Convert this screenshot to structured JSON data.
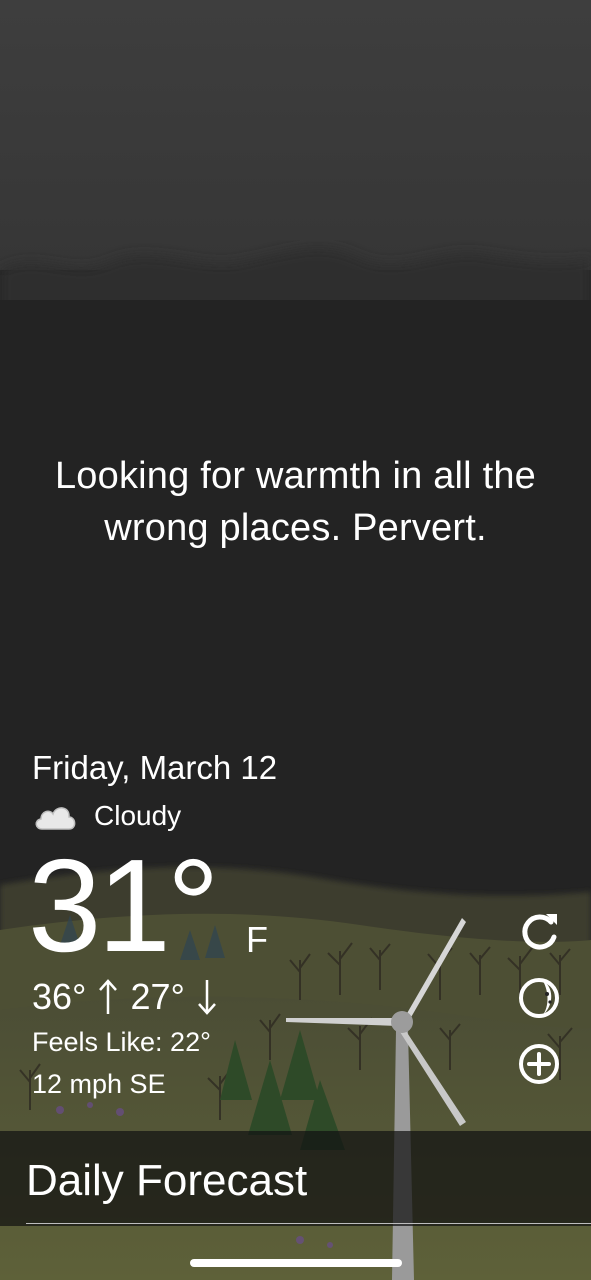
{
  "quote": "Looking for warmth in all the wrong places. Pervert.",
  "weather": {
    "date": "Friday, March 12",
    "condition": "Cloudy",
    "condition_icon": "cloud-icon",
    "temperature": "31°",
    "unit": "F",
    "high": "36°",
    "low": "27°",
    "feels_like": "Feels Like: 22°",
    "wind": "12 mph SE"
  },
  "actions": {
    "refresh_icon": "refresh-icon",
    "theme_icon": "moon-icon",
    "add_icon": "add-circle-icon"
  },
  "forecast": {
    "title": "Daily Forecast"
  },
  "colors": {
    "sky_top": "#3e3e3e",
    "background": "#232323",
    "hill": "#56583a",
    "text": "#ffffff"
  }
}
